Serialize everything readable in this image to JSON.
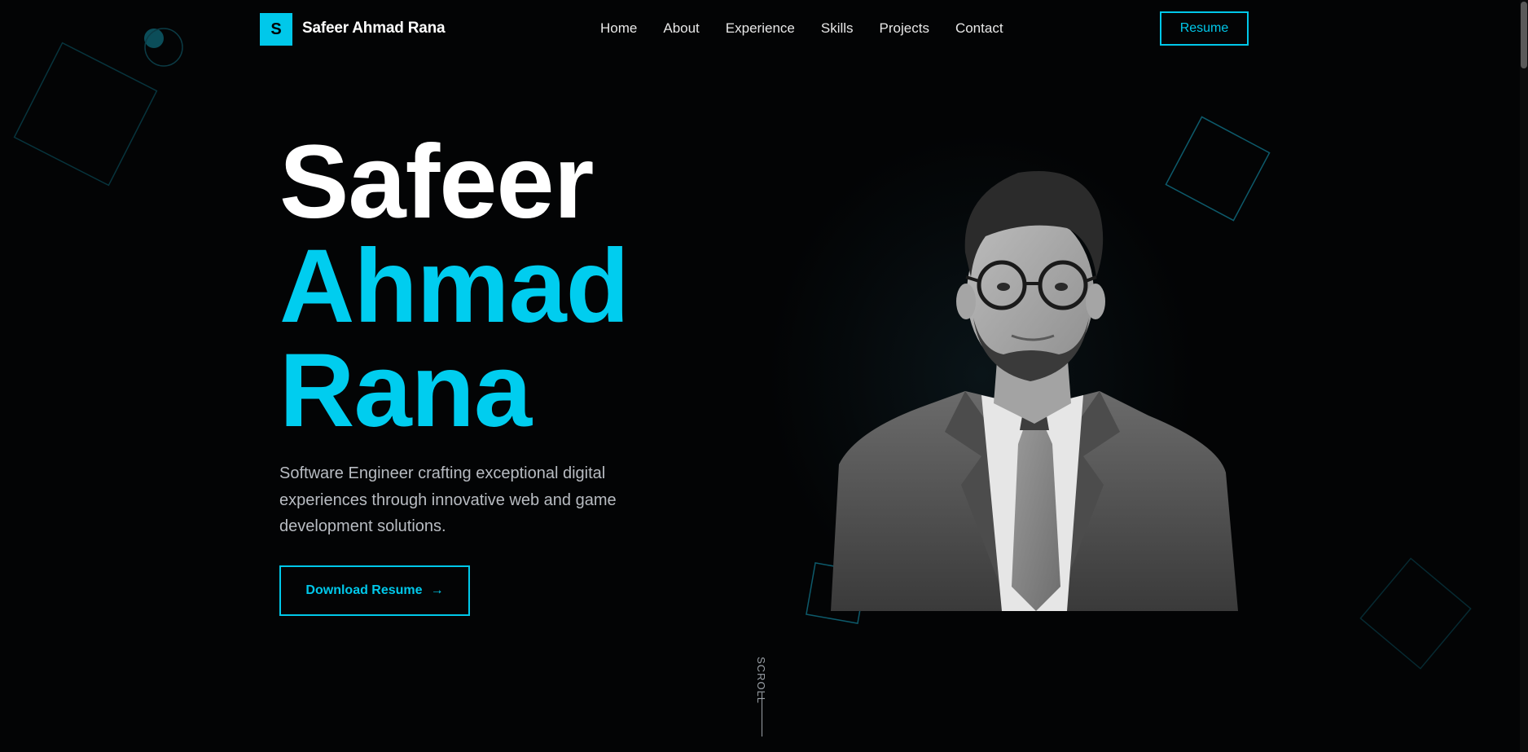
{
  "nav": {
    "logo_letter": "S",
    "logo_name": "Safeer Ahmad Rana",
    "links": [
      "Home",
      "About",
      "Experience",
      "Skills",
      "Projects",
      "Contact"
    ],
    "resume_label": "Resume"
  },
  "hero": {
    "title_line1": "Safeer",
    "title_line2": "Ahmad",
    "title_line3": "Rana",
    "subtitle": "Software Engineer crafting exceptional digital experiences through innovative web and game development solutions.",
    "cta_label": "Download Resume",
    "cta_arrow": "→"
  },
  "scroll_label": "SCROLL",
  "colors": {
    "accent": "#00c8ea",
    "background": "#030405",
    "text": "#ffffff",
    "muted": "#b8bcc2"
  },
  "icons": [
    "arrow-right-icon"
  ]
}
